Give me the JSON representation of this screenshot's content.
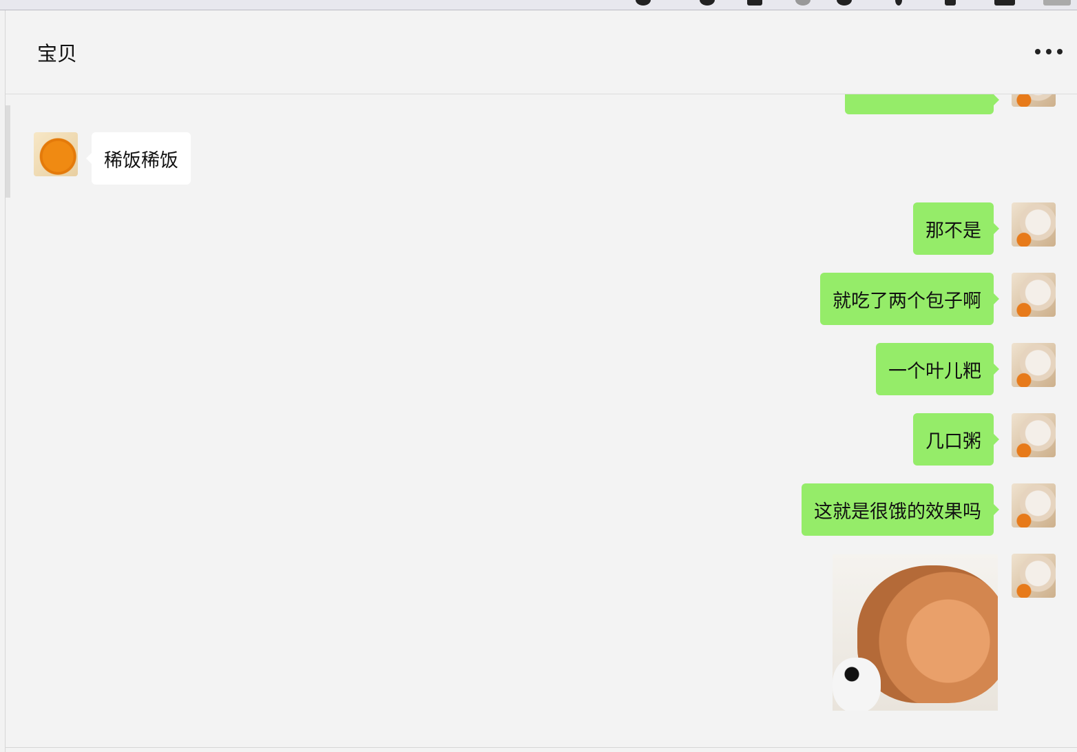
{
  "chat": {
    "title": "宝贝"
  },
  "messages": [
    {
      "side": "out",
      "text": "",
      "partial": true
    },
    {
      "side": "in",
      "text": "稀饭稀饭"
    },
    {
      "side": "out",
      "text": "那不是"
    },
    {
      "side": "out",
      "text": "就吃了两个包子啊"
    },
    {
      "side": "out",
      "text": "一个叶儿粑"
    },
    {
      "side": "out",
      "text": "几口粥"
    },
    {
      "side": "out",
      "text": "这就是很饿的效果吗"
    },
    {
      "side": "out",
      "type": "image"
    }
  ],
  "colors": {
    "out_bubble": "#95ec69",
    "in_bubble": "#ffffff",
    "background": "#f3f3f3"
  },
  "icons": {
    "more": "more-horizontal-icon"
  }
}
